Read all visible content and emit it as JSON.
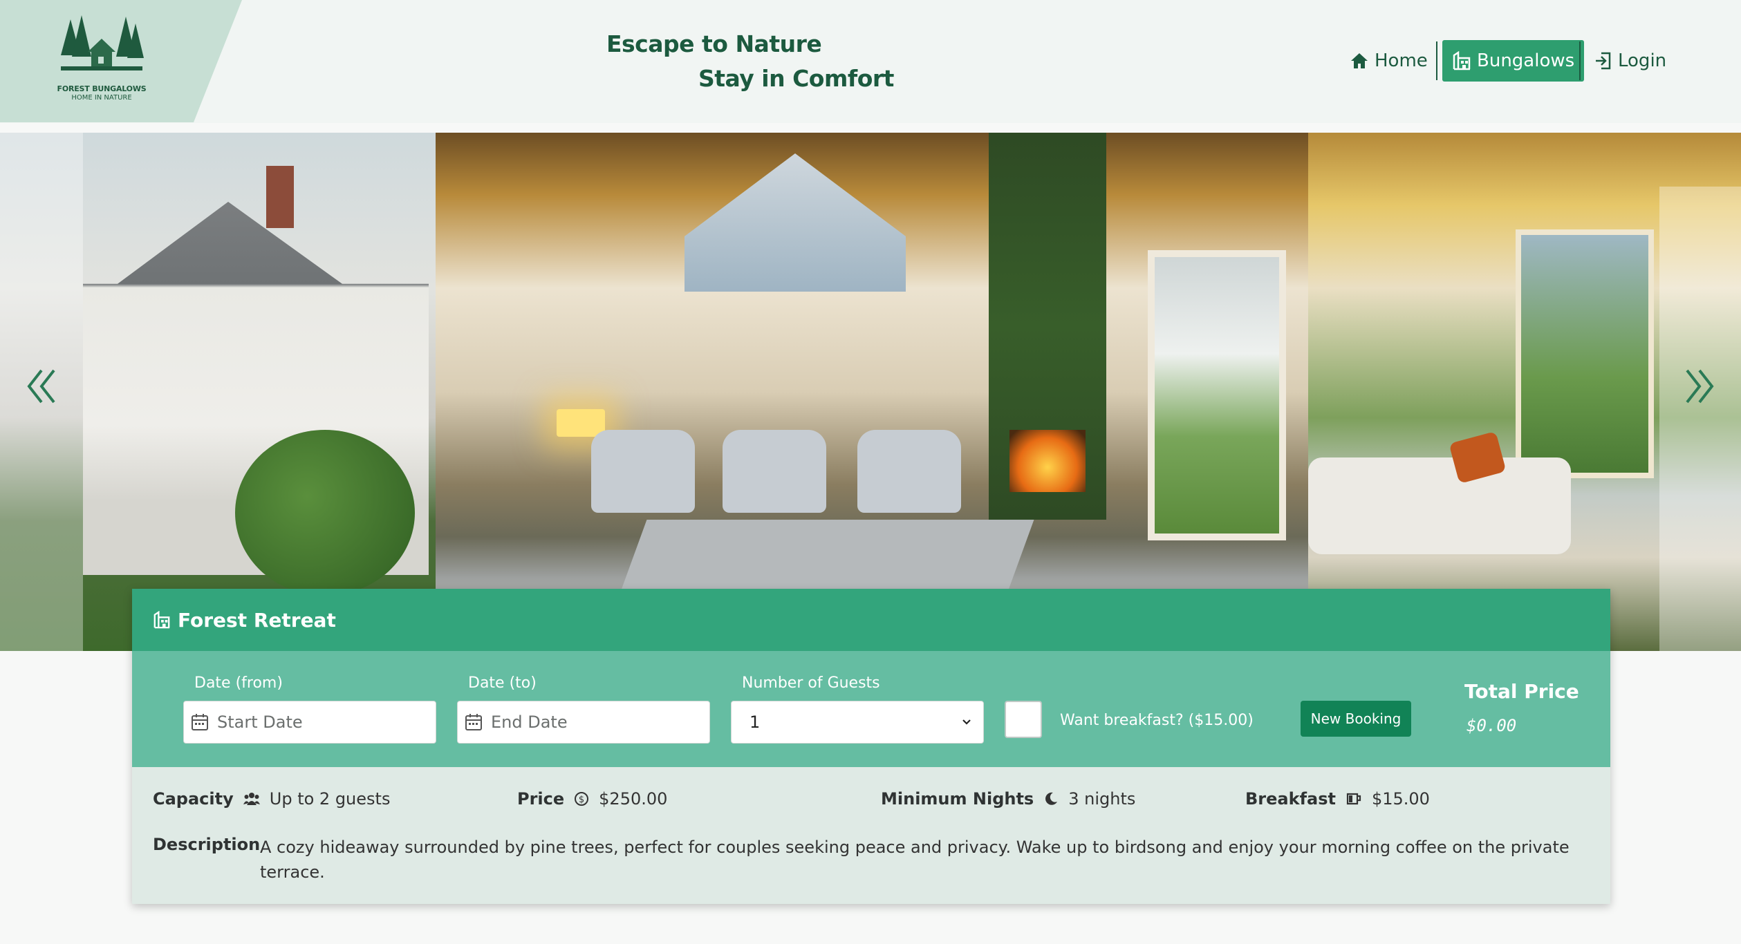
{
  "brand": {
    "title": "FOREST BUNGALOWS",
    "subtitle": "HOME IN NATURE"
  },
  "header": {
    "tagline_1": "Escape to Nature",
    "tagline_2": "Stay in Comfort"
  },
  "nav": {
    "home": "Home",
    "bungalows": "Bungalows",
    "login": "Login",
    "active": "Bungalows"
  },
  "card": {
    "title": "Forest Retreat",
    "form": {
      "date_from_label": "Date (from)",
      "date_from_placeholder": "Start Date",
      "date_to_label": "Date (to)",
      "date_to_placeholder": "End Date",
      "guests_label": "Number of Guests",
      "guests_value": "1",
      "breakfast_label": "Want breakfast? ($15.00)",
      "breakfast_checked": false,
      "new_booking": "New Booking",
      "total_label": "Total Price",
      "total_value": "$0.00"
    },
    "details": {
      "capacity_label": "Capacity",
      "capacity_value": "Up to 2 guests",
      "price_label": "Price",
      "price_value": "$250.00",
      "min_nights_label": "Minimum Nights",
      "min_nights_value": "3 nights",
      "breakfast_label": "Breakfast",
      "breakfast_value": "$15.00",
      "description_label": "Description",
      "description_text": "A cozy hideaway surrounded by pine trees, perfect for couples seeking peace and privacy. Wake up to birdsong and enjoy your morning coffee on the private terrace."
    }
  },
  "colors": {
    "brand_dark": "#1c5a3f",
    "accent": "#2e9e6f",
    "card_header": "#33a57c",
    "card_form": "#65bda2",
    "card_body": "#dfeae5",
    "button": "#118356"
  },
  "icons": {
    "home": "home-icon",
    "bungalows": "building-icon",
    "login": "login-icon",
    "prev": "chevrons-left-icon",
    "next": "chevrons-right-icon",
    "calendar": "calendar-icon",
    "capacity": "users-icon",
    "price": "dollar-circle-icon",
    "nights": "moon-icon",
    "breakfast": "cup-icon"
  }
}
